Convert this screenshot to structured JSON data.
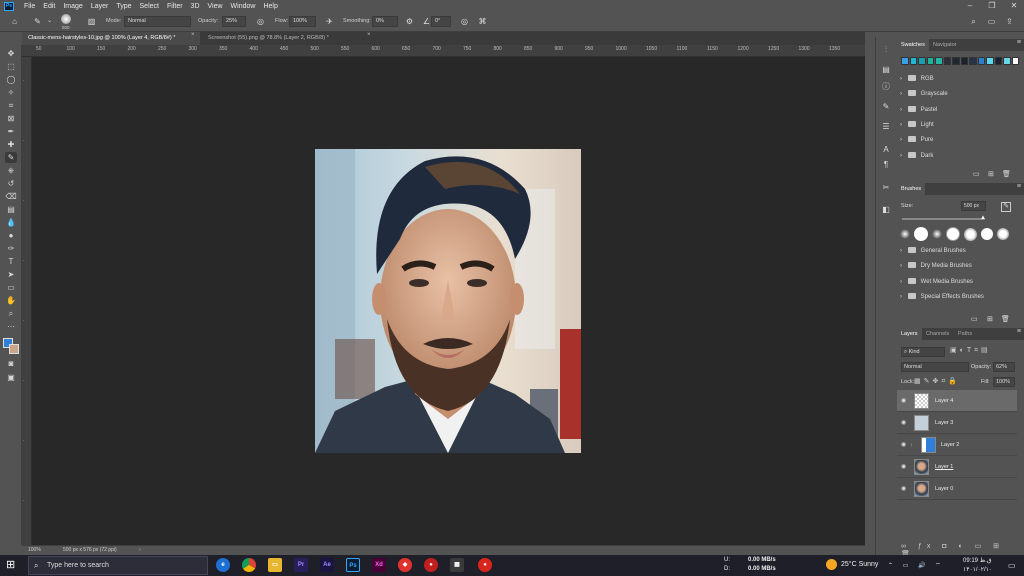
{
  "menubar": {
    "app_logo": "Ps",
    "items": [
      "File",
      "Edit",
      "Image",
      "Layer",
      "Type",
      "Select",
      "Filter",
      "3D",
      "View",
      "Window",
      "Help"
    ]
  },
  "options": {
    "brush_size": "500",
    "mode_label": "Mode:",
    "mode_value": "Normal",
    "opacity_label": "Opacity:",
    "opacity_value": "25%",
    "flow_label": "Flow:",
    "flow_value": "100%",
    "smoothing_label": "Smoothing:",
    "smoothing_value": "0%",
    "angle_value": "0°"
  },
  "tabs": [
    {
      "label": "Classic-mens-hairstyles-10.jpg @ 100% (Layer 4, RGB/8#) *"
    },
    {
      "label": "Screenshot (55).png @ 78.8% (Layer 2, RGB/8) *"
    }
  ],
  "ruler": {
    "top": [
      "50",
      "100",
      "150",
      "200",
      "250",
      "300",
      "350",
      "400",
      "450",
      "500",
      "550",
      "600",
      "650",
      "700",
      "750",
      "800",
      "850",
      "900",
      "950",
      "1000",
      "1050",
      "1100",
      "1150",
      "1200",
      "1250",
      "1300",
      "1350"
    ]
  },
  "status": {
    "zoom": "100%",
    "doc_info": "500 px x 576 px (72 ppi)"
  },
  "swatches": {
    "tabs": [
      "Swatches",
      "Navigator"
    ],
    "colors": [
      "#3aa0e8",
      "#1fb7d4",
      "#1a9fb0",
      "#1fb39a",
      "#23b5a8",
      "#2a2f3a",
      "#1f2733",
      "#1a2230",
      "#2a3344",
      "#2a7fd0",
      "#5ad8f0",
      "#1b2330",
      "#6ad4e8",
      "#ffffff"
    ],
    "groups": [
      "RGB",
      "Grayscale",
      "Pastel",
      "Light",
      "Pure",
      "Dark"
    ]
  },
  "brushes": {
    "title": "Brushes",
    "size_label": "Size:",
    "size_value": "500 px",
    "groups": [
      "General Brushes",
      "Dry Media Brushes",
      "Wet Media Brushes",
      "Special Effects Brushes"
    ]
  },
  "layers": {
    "tabs": [
      "Layers",
      "Channels",
      "Paths"
    ],
    "kind_label": "Kind",
    "blend_mode": "Normal",
    "opacity_label": "Opacity:",
    "opacity_value": "62%",
    "lock_label": "Lock:",
    "fill_label": "Fill:",
    "fill_value": "100%",
    "items": [
      {
        "name": "Layer 4",
        "selected": true
      },
      {
        "name": "Layer 3",
        "selected": false
      },
      {
        "name": "Layer 2",
        "selected": false
      },
      {
        "name": "Layer 1",
        "selected": false
      },
      {
        "name": "Layer 0",
        "selected": false
      }
    ]
  },
  "taskbar": {
    "search_placeholder": "Type here to search",
    "upload_label": "U:",
    "download_label": "D:",
    "upload_speed": "0.00 MB/s",
    "download_speed": "0.00 MB/s",
    "weather": "25°C  Sunny",
    "time": "09:19 ق.ظ",
    "date": "۱۴۰۱/۰۲/۱۰"
  }
}
